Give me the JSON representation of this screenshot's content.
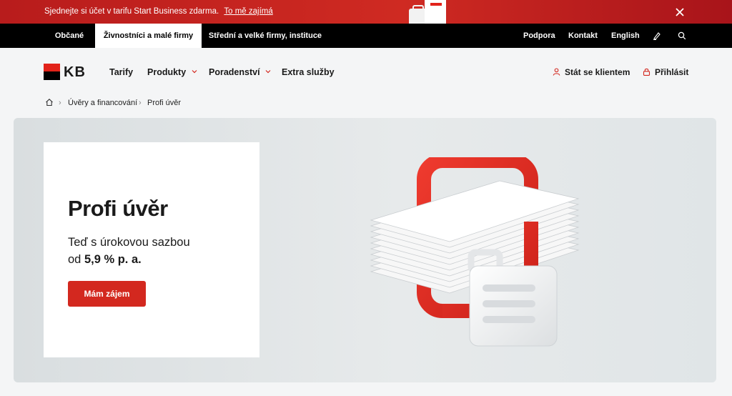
{
  "promo": {
    "text": "Sjednejte si účet v tarifu Start Business zdarma.",
    "link": "To mě zajímá"
  },
  "segments": [
    "Občané",
    "Živnostníci a malé firmy",
    "Střední a velké firmy, instituce"
  ],
  "utility": {
    "support": "Podpora",
    "contact": "Kontakt",
    "language": "English",
    "icons": [
      "signature-icon",
      "search-icon"
    ]
  },
  "header": {
    "logo": "KB",
    "nav": [
      "Tarify",
      "Produkty",
      "Poradenství",
      "Extra služby"
    ],
    "become_client": "Stát se klientem",
    "login": "Přihlásit"
  },
  "breadcrumb": [
    "Úvěry a financování",
    "Profi úvěr"
  ],
  "hero": {
    "title": "Profi úvěr",
    "subtitle_line1": "Teď s úrokovou sazbou",
    "subtitle_prefix": "od ",
    "subtitle_rate": "5,9 % p. a.",
    "cta": "Mám zájem"
  },
  "colors": {
    "brand_red": "#d3281f",
    "black": "#000000"
  }
}
